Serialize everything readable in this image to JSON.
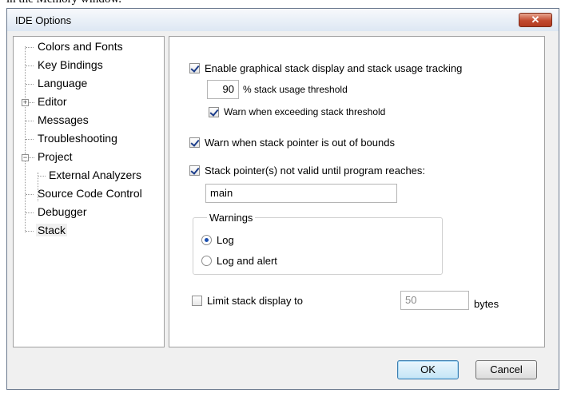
{
  "top_fragment": "in the Memory window.",
  "dialog": {
    "title": "IDE Options",
    "close_glyph": "✕"
  },
  "tree": {
    "items": [
      {
        "label": "Colors and Fonts"
      },
      {
        "label": "Key Bindings"
      },
      {
        "label": "Language"
      },
      {
        "label": "Editor",
        "expander": "+"
      },
      {
        "label": "Messages"
      },
      {
        "label": "Troubleshooting"
      },
      {
        "label": "Project",
        "expander": "−"
      },
      {
        "label": "External Analyzers"
      },
      {
        "label": "Source Code Control"
      },
      {
        "label": "Debugger"
      },
      {
        "label": "Stack",
        "selected": true
      }
    ]
  },
  "stack": {
    "enable_graphical": {
      "label": "Enable graphical stack display and stack usage tracking",
      "checked": true
    },
    "threshold": {
      "value": "90",
      "label": "% stack usage threshold"
    },
    "warn_threshold": {
      "label": "Warn when exceeding stack threshold",
      "checked": true
    },
    "warn_out_of_bounds": {
      "label": "Warn when stack pointer is out of bounds",
      "checked": true
    },
    "sp_not_valid": {
      "label": "Stack pointer(s) not valid until program reaches:",
      "checked": true
    },
    "program_point": {
      "value": "main"
    },
    "warnings": {
      "legend": "Warnings",
      "log": {
        "label": "Log",
        "selected": true
      },
      "log_alert": {
        "label": "Log and alert",
        "selected": false
      }
    },
    "limit": {
      "label": "Limit stack display to",
      "checked": false,
      "value": "50",
      "unit": "bytes"
    }
  },
  "buttons": {
    "ok": "OK",
    "cancel": "Cancel"
  },
  "colors": {
    "accent": "#1c4fb0",
    "close": "#c24a2f"
  }
}
